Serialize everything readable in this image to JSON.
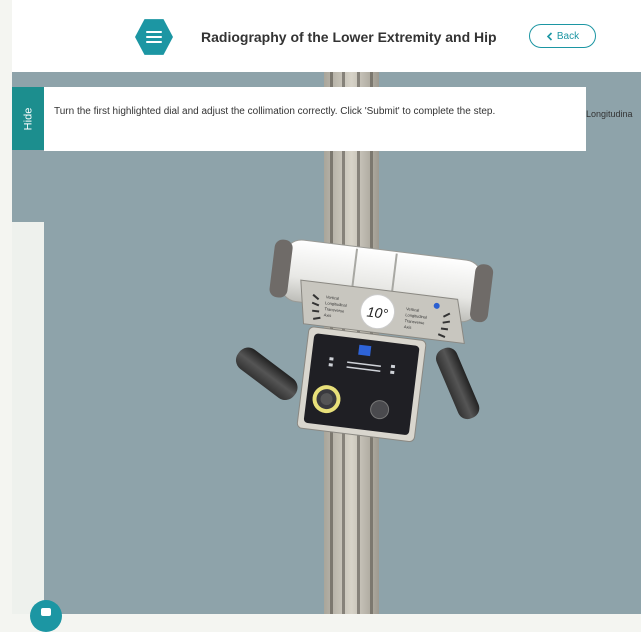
{
  "header": {
    "title": "Radiography of the Lower Extremity and Hip",
    "back_label": "Back",
    "menu_icon": "hamburger-icon",
    "back_icon": "chevron-left-icon"
  },
  "sidebar": {
    "hide_label": "Hide"
  },
  "instruction": {
    "text": "Turn the first highlighted dial and adjust the collimation correctly. Click 'Submit' to complete the step."
  },
  "side_label": "Longitudina",
  "device": {
    "angle_display": "10°",
    "left_dial_text": "Vertical / Longitudinal / Transverse / Axis",
    "right_dial_text": "Vertical / Longitudinal / Transverse / Axis"
  },
  "colors": {
    "accent": "#1c96a3",
    "hide_tab": "#1c8e8e",
    "viewport_bg": "#8ea3aa",
    "highlight_ring": "#e8e07a"
  }
}
